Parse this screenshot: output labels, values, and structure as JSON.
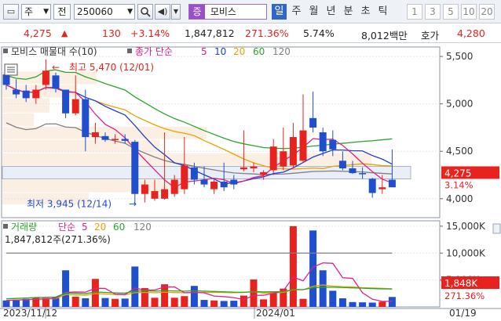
{
  "toolbar": {
    "window_icon": "window-icon",
    "market": "주",
    "period_selector": "전",
    "code": "250060",
    "name": "모비스",
    "name_prefix": "증",
    "tabs": [
      "일",
      "주",
      "월",
      "년",
      "분",
      "초",
      "틱"
    ],
    "active_tab": "일",
    "num_tabs": [
      "1",
      "3",
      "5",
      "10",
      "20"
    ]
  },
  "info": {
    "price": "4,275",
    "change": "130",
    "change_pct": "+3.14%",
    "volume": "1,847,812",
    "volume_ratio": "271.36%",
    "turnover": "5.74%",
    "amount": "8,012백만",
    "ask_label": "호가",
    "ask_price": "4,280"
  },
  "colors": {
    "up": "#e8231f",
    "down": "#1f4fcf",
    "ma5": "#e0218a",
    "ma10": "#1f3fcf",
    "ma20": "#e8a100",
    "ma60": "#2aa52a",
    "ma120": "#808080"
  },
  "chart_data": {
    "type": "candlestick",
    "price_panel": {
      "legend_title": "모비스 매물대 수(10)",
      "ma_legend_prefix": "종가 단순",
      "ma_periods": [
        "5",
        "10",
        "20",
        "60",
        "120"
      ],
      "y_ticks": [
        "5,500",
        "5,000",
        "4,500",
        "4,000"
      ],
      "y_range": [
        3800,
        5600
      ],
      "high_label": "최고 5,470 (12/01)",
      "low_label": "최저 3,945 (12/14)",
      "current_price_label": "4,275",
      "current_change_label": "3.14%",
      "candles": [
        {
          "o": 5310,
          "h": 5380,
          "l": 5150,
          "c": 5200
        },
        {
          "o": 5150,
          "h": 5260,
          "l": 5060,
          "c": 5100
        },
        {
          "o": 5140,
          "h": 5200,
          "l": 5020,
          "c": 5060
        },
        {
          "o": 5060,
          "h": 5200,
          "l": 5000,
          "c": 5150
        },
        {
          "o": 5200,
          "h": 5470,
          "l": 5150,
          "c": 5350
        },
        {
          "o": 5300,
          "h": 5330,
          "l": 5120,
          "c": 5160
        },
        {
          "o": 5150,
          "h": 5150,
          "l": 4850,
          "c": 4900
        },
        {
          "o": 4900,
          "h": 5300,
          "l": 4880,
          "c": 5050
        },
        {
          "o": 5050,
          "h": 5150,
          "l": 4500,
          "c": 4650
        },
        {
          "o": 4650,
          "h": 4800,
          "l": 4580,
          "c": 4700
        },
        {
          "o": 4660,
          "h": 4700,
          "l": 4600,
          "c": 4620
        },
        {
          "o": 4620,
          "h": 4680,
          "l": 4580,
          "c": 4630
        },
        {
          "o": 4630,
          "h": 4680,
          "l": 4580,
          "c": 4610
        },
        {
          "o": 4600,
          "h": 4620,
          "l": 3945,
          "c": 4050
        },
        {
          "o": 4050,
          "h": 4200,
          "l": 3960,
          "c": 4150
        },
        {
          "o": 4000,
          "h": 4200,
          "l": 3980,
          "c": 4080
        },
        {
          "o": 4000,
          "h": 4700,
          "l": 3990,
          "c": 4100
        },
        {
          "o": 4050,
          "h": 4250,
          "l": 4020,
          "c": 4200
        },
        {
          "o": 4100,
          "h": 4650,
          "l": 4050,
          "c": 4350
        },
        {
          "o": 4330,
          "h": 4380,
          "l": 4150,
          "c": 4200
        },
        {
          "o": 4200,
          "h": 4340,
          "l": 4120,
          "c": 4150
        },
        {
          "o": 4100,
          "h": 4200,
          "l": 4050,
          "c": 4180
        },
        {
          "o": 4180,
          "h": 4380,
          "l": 4080,
          "c": 4120
        },
        {
          "o": 4200,
          "h": 4250,
          "l": 4100,
          "c": 4150
        },
        {
          "o": 4310,
          "h": 4720,
          "l": 4290,
          "c": 4330
        },
        {
          "o": 4320,
          "h": 4380,
          "l": 4280,
          "c": 4340
        },
        {
          "o": 4250,
          "h": 4300,
          "l": 4200,
          "c": 4280
        },
        {
          "o": 4300,
          "h": 4630,
          "l": 4250,
          "c": 4550
        },
        {
          "o": 4340,
          "h": 4750,
          "l": 4300,
          "c": 4500
        },
        {
          "o": 4350,
          "h": 4800,
          "l": 4320,
          "c": 4650
        },
        {
          "o": 4400,
          "h": 5100,
          "l": 4380,
          "c": 4720
        },
        {
          "o": 4850,
          "h": 5130,
          "l": 4700,
          "c": 4750
        },
        {
          "o": 4700,
          "h": 4750,
          "l": 4450,
          "c": 4500
        },
        {
          "o": 4620,
          "h": 4720,
          "l": 4450,
          "c": 4520
        },
        {
          "o": 4400,
          "h": 4500,
          "l": 4300,
          "c": 4320
        },
        {
          "o": 4320,
          "h": 4400,
          "l": 4260,
          "c": 4270
        },
        {
          "o": 4270,
          "h": 4330,
          "l": 4210,
          "c": 4260
        },
        {
          "o": 4210,
          "h": 4220,
          "l": 4010,
          "c": 4060
        },
        {
          "o": 4100,
          "h": 4250,
          "l": 4050,
          "c": 4120
        },
        {
          "o": 4200,
          "h": 4520,
          "l": 4150,
          "c": 4120
        }
      ]
    },
    "volume_panel": {
      "legend_title": "거래량",
      "ma_legend_prefix": "단순",
      "ma_periods": [
        "5",
        "20",
        "60",
        "120"
      ],
      "volume_label": "1,847,812주(271.36%)",
      "y_ticks": [
        "15,000K",
        "10,000K",
        "5,000K"
      ],
      "y_range": [
        0,
        16000
      ],
      "current_volume_label": "1,848K",
      "current_pct_label": "271.36%",
      "volumes": [
        1200,
        1350,
        1500,
        1700,
        1650,
        1800,
        6800,
        1900,
        1600,
        5200,
        1650,
        1500,
        1550,
        7500,
        3500,
        1700,
        4200,
        1700,
        2000,
        3900,
        1300,
        1200,
        1100,
        1150,
        2100,
        5100,
        1400,
        2900,
        3400,
        15000,
        1500,
        14200,
        6800,
        3000,
        1600,
        900,
        850,
        800,
        950,
        1848
      ]
    },
    "x_labels": [
      "2023/11/12",
      "2024/01",
      "01/19"
    ]
  }
}
